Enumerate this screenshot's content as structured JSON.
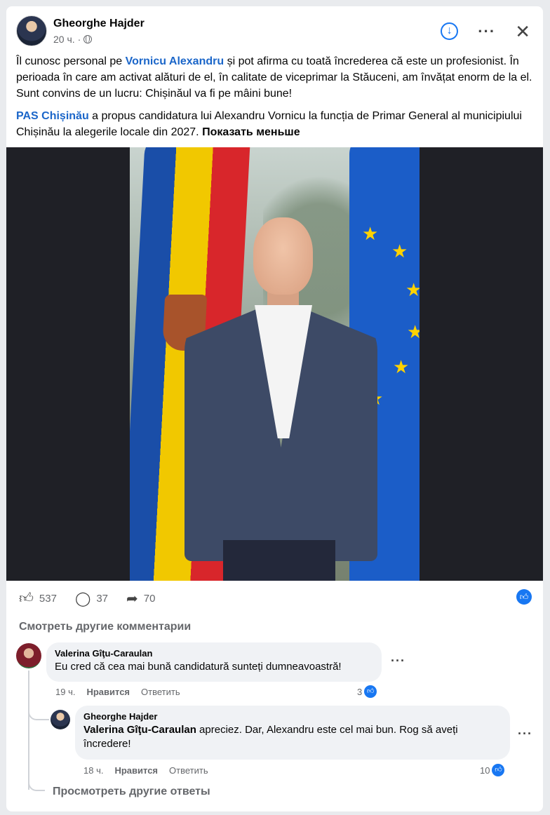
{
  "post": {
    "author": "Gheorghe Hajder",
    "time": "20 ч.",
    "separator": "·",
    "p1_link": "Vornicu Alexandru",
    "p1_before": "Îl cunosc personal pe ",
    "p1_after": " și pot afirma cu toată încrederea că este un profesionist. În perioada în care am activat alături de el, în calitate de viceprimar la Stăuceni, am învățat enorm de la el. Sunt convins de un lucru: Chișinăul va fi pe mâini bune!",
    "p2_link": "PAS Chișinău",
    "p2_after": " a propus candidatura lui Alexandru Vornicu la funcția de Primar General al municipiului Chișinău la alegerile locale din 2027. ",
    "show_less": "Показать меньше"
  },
  "icons": {
    "download": "download-icon",
    "more": "more-options-icon",
    "close": "close-icon",
    "globe": "globe-icon",
    "like": "like-icon",
    "comment": "comment-icon",
    "share": "share-icon"
  },
  "stats": {
    "likes": "537",
    "comments": "37",
    "shares": "70"
  },
  "comments": {
    "see_more": "Смотреть другие комментарии",
    "c1": {
      "name": "Valerina Gîţu-Caraulan",
      "text": "Eu cred că cea mai bună candidatură sunteți dumneavoastră!",
      "time": "19 ч.",
      "like": "Нравится",
      "reply": "Ответить",
      "likes": "3"
    },
    "c2": {
      "name": "Gheorghe Hajder",
      "mention": "Valerina Gîţu-Caraulan",
      "text": " apreciez. Dar, Alexandru este cel mai bun. Rog să aveți încredere!",
      "time": "18 ч.",
      "like": "Нравится",
      "reply": "Ответить",
      "likes": "10"
    },
    "more_replies": "Просмотреть другие ответы"
  },
  "colors": {
    "accent": "#1877f2",
    "link": "#1b66c9",
    "muted": "#65676b"
  }
}
